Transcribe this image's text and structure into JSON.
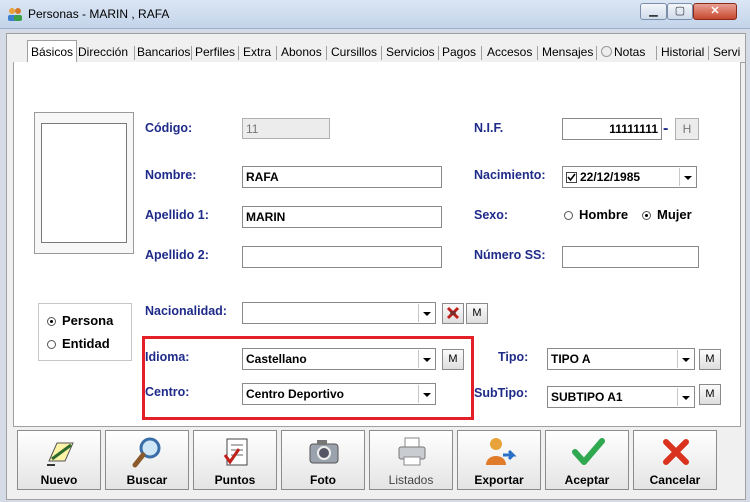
{
  "window": {
    "title": "Personas - MARIN , RAFA"
  },
  "tabs": [
    "Básicos",
    "Dirección",
    "Bancarios",
    "Perfiles",
    "Extra",
    "Abonos",
    "Cursillos",
    "Servicios",
    "Pagos",
    "Accesos",
    "Mensajes",
    "Notas",
    "Historial",
    "Servi"
  ],
  "form": {
    "codigo_label": "Código:",
    "codigo_value": "11",
    "nombre_label": "Nombre:",
    "nombre_value": "RAFA",
    "apellido1_label": "Apellido 1:",
    "apellido1_value": "MARIN",
    "apellido2_label": "Apellido 2:",
    "apellido2_value": "",
    "nacionalidad_label": "Nacionalidad:",
    "nacionalidad_value": "",
    "idioma_label": "Idioma:",
    "idioma_value": "Castellano",
    "centro_label": "Centro:",
    "centro_value": "Centro Deportivo",
    "nif_label": "N.I.F.",
    "nif_value": "11111111",
    "nif_letter": "H",
    "nif_dash": "-",
    "nacimiento_label": "Nacimiento:",
    "nacimiento_value": "22/12/1985",
    "sexo_label": "Sexo:",
    "sexo_hombre": "Hombre",
    "sexo_mujer": "Mujer",
    "numss_label": "Número SS:",
    "numss_value": "",
    "tipo_label": "Tipo:",
    "tipo_value": "TIPO A",
    "subtipo_label": "SubTipo:",
    "subtipo_value": "SUBTIPO A1",
    "m_label": "M",
    "persona_label": "Persona",
    "entidad_label": "Entidad"
  },
  "buttons": [
    "Nuevo",
    "Buscar",
    "Puntos",
    "Foto",
    "Listados",
    "Exportar",
    "Aceptar",
    "Cancelar"
  ],
  "colors": {
    "label_blue": "#1f2b89",
    "highlight_red": "#e32027",
    "accept_green": "#2fa84f",
    "cancel_red": "#d9331f"
  }
}
